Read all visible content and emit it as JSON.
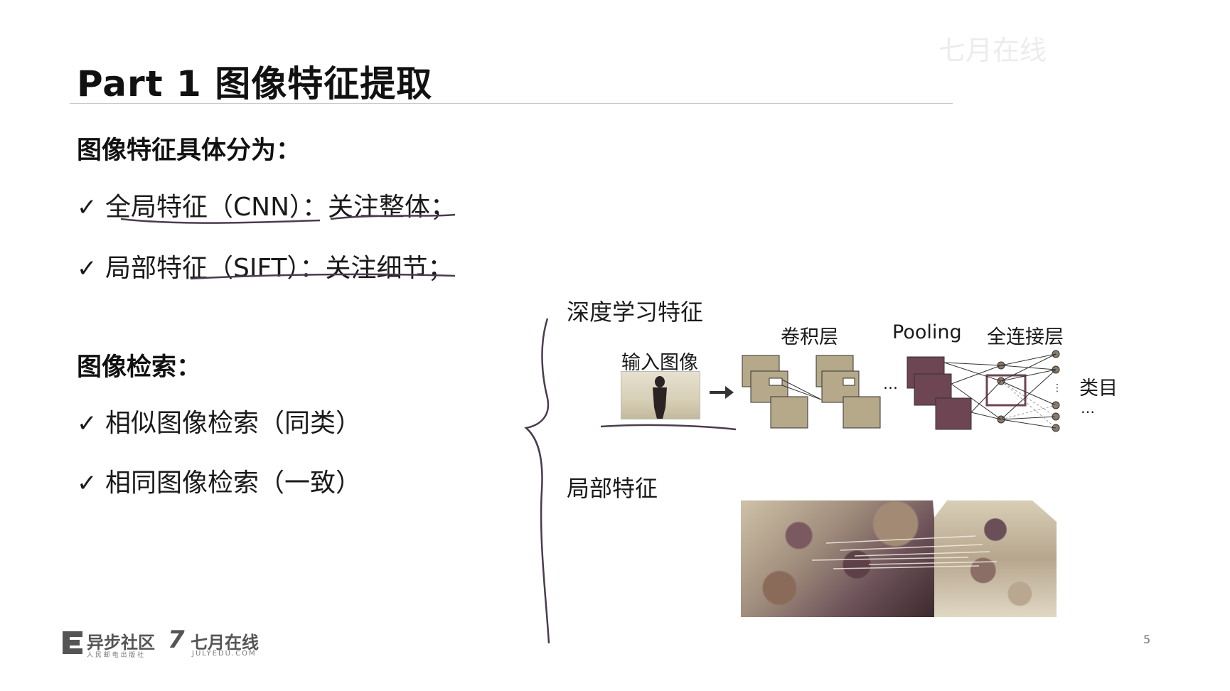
{
  "slide": {
    "title": "Part 1 图像特征提取",
    "page_number": "5"
  },
  "left": {
    "section1_heading": "图像特征具体分为：",
    "section1_items": [
      "全局特征（CNN）：关注整体；",
      "局部特征（SIFT）：关注细节；"
    ],
    "section2_heading": "图像检索：",
    "section2_items": [
      "相似图像检索（同类）",
      "相同图像检索（一致）"
    ],
    "check_glyph": "✓"
  },
  "diagram": {
    "deep_heading": "深度学习特征",
    "input_label": "输入图像",
    "conv_label": "卷积层",
    "pooling_label": "Pooling",
    "fc_label": "全连接层",
    "class_label": "类目",
    "ellipsis": "...",
    "ellipsis2": "…",
    "local_heading": "局部特征"
  },
  "logos": {
    "logo1": "异步社区",
    "logo1_sub": "人 民 邮 电 出 版 社",
    "logo2_mark": "7",
    "logo2": "七月在线",
    "logo2_sub": "JULYEDU.COM"
  },
  "colors": {
    "conv_fill": "#b5a98a",
    "pool_fill": "#6e4553",
    "annotation_ink": "#4a3c4f"
  },
  "icons": {
    "check": "check-icon",
    "arrow": "right-arrow-icon",
    "brace": "curly-brace-icon"
  }
}
